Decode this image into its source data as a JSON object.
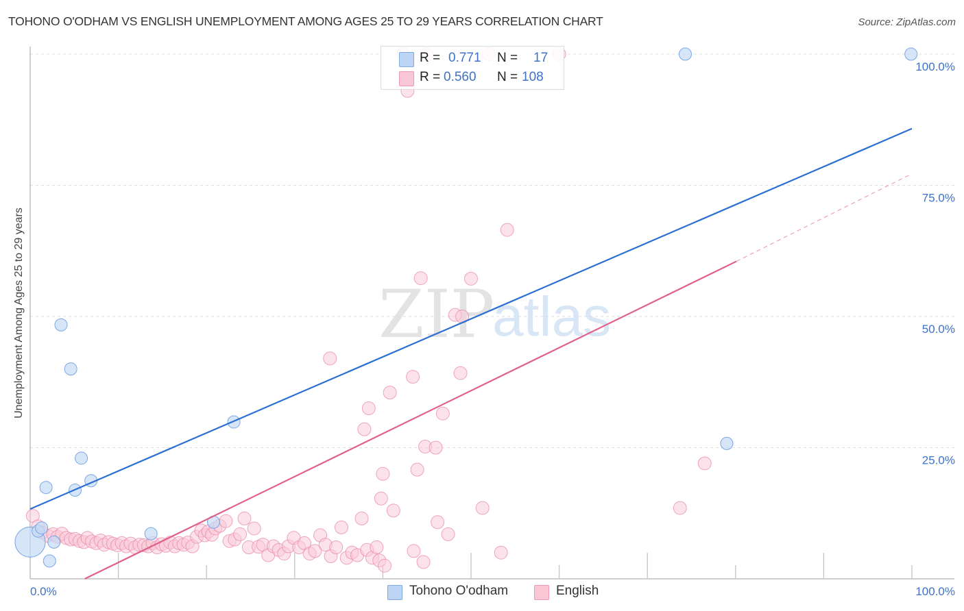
{
  "header": {
    "title": "TOHONO O'ODHAM VS ENGLISH UNEMPLOYMENT AMONG AGES 25 TO 29 YEARS CORRELATION CHART",
    "source": "Source: ZipAtlas.com"
  },
  "watermark": {
    "zip": "ZIP",
    "atlas": "atlas"
  },
  "legend": {
    "rows": [
      {
        "r_label": "R =",
        "r_value": "0.771",
        "n_label": "N =",
        "n_value": "17",
        "color": "#a9c8f0"
      },
      {
        "r_label": "R =",
        "r_value": "0.560",
        "n_label": "N =",
        "n_value": "108",
        "color": "#f7b8cb"
      }
    ]
  },
  "bottom_legend": [
    {
      "label": "Tohono O'odham",
      "color": "#a9c8f0"
    },
    {
      "label": "English",
      "color": "#f7b8cb"
    }
  ],
  "colors": {
    "blue_fill": "#c5daf5",
    "blue_stroke": "#6d9fe0",
    "blue_line": "#2a6fd1",
    "pink_fill": "#f9cad8",
    "pink_stroke": "#e98aa8",
    "pink_line": "#e0608a",
    "tick_text": "#3d72c8"
  },
  "chart_data": {
    "type": "scatter",
    "title": "TOHONO O'ODHAM VS ENGLISH UNEMPLOYMENT AMONG AGES 25 TO 29 YEARS CORRELATION CHART",
    "xlabel": "",
    "ylabel": "Unemployment Among Ages 25 to 29 years",
    "xlim": [
      0,
      100
    ],
    "ylim": [
      0,
      100
    ],
    "x_tick_labels": [
      "0.0%",
      "100.0%"
    ],
    "y_ticks": [
      25,
      50,
      75,
      100
    ],
    "y_tick_labels": [
      "25.0%",
      "50.0%",
      "75.0%",
      "100.0%"
    ],
    "grid": true,
    "legend_position": "top-center",
    "series": [
      {
        "name": "Tohono O'odham",
        "r": 0.771,
        "n": 17,
        "trend": {
          "x0": 0,
          "y0": 13.3,
          "x1": 100,
          "y1": 85.8
        },
        "points": [
          [
            0.0,
            7.0
          ],
          [
            0.9,
            9.1
          ],
          [
            1.3,
            9.7
          ],
          [
            1.8,
            17.4
          ],
          [
            2.2,
            3.4
          ],
          [
            2.7,
            7.0
          ],
          [
            3.5,
            48.4
          ],
          [
            4.6,
            40.0
          ],
          [
            5.1,
            16.9
          ],
          [
            5.8,
            23.0
          ],
          [
            6.9,
            18.7
          ],
          [
            13.7,
            8.6
          ],
          [
            20.8,
            10.8
          ],
          [
            23.1,
            29.9
          ],
          [
            74.3,
            100.0
          ],
          [
            79.0,
            25.8
          ],
          [
            99.9,
            100.0
          ]
        ],
        "point_sizes": [
          3,
          1,
          1,
          1,
          1,
          1,
          1,
          1,
          1,
          1,
          1,
          1,
          1,
          1,
          1,
          1,
          1
        ]
      },
      {
        "name": "English",
        "r": 0.56,
        "n": 108,
        "trend": {
          "x0": 6.2,
          "y0": 0,
          "x1": 80.1,
          "y1": 60.5,
          "dashed_to": {
            "x": 100,
            "y": 77.2
          }
        },
        "points": [
          [
            0.3,
            12.0
          ],
          [
            0.9,
            10.0
          ],
          [
            1.4,
            8.8
          ],
          [
            2.0,
            8.2
          ],
          [
            2.6,
            8.5
          ],
          [
            3.1,
            8.0
          ],
          [
            3.6,
            8.6
          ],
          [
            4.1,
            7.8
          ],
          [
            4.6,
            7.5
          ],
          [
            5.1,
            7.6
          ],
          [
            5.6,
            7.2
          ],
          [
            6.1,
            7.0
          ],
          [
            6.5,
            7.8
          ],
          [
            7.0,
            7.1
          ],
          [
            7.5,
            6.8
          ],
          [
            8.0,
            7.3
          ],
          [
            8.4,
            6.5
          ],
          [
            8.9,
            7.0
          ],
          [
            9.4,
            6.7
          ],
          [
            9.9,
            6.4
          ],
          [
            10.4,
            6.8
          ],
          [
            10.9,
            6.2
          ],
          [
            11.4,
            6.7
          ],
          [
            11.9,
            6.0
          ],
          [
            12.4,
            6.5
          ],
          [
            12.9,
            6.4
          ],
          [
            13.4,
            6.2
          ],
          [
            13.9,
            6.8
          ],
          [
            14.4,
            6.0
          ],
          [
            14.9,
            6.6
          ],
          [
            15.4,
            6.3
          ],
          [
            15.9,
            6.9
          ],
          [
            16.4,
            6.2
          ],
          [
            16.9,
            6.8
          ],
          [
            17.4,
            6.5
          ],
          [
            17.9,
            6.9
          ],
          [
            18.4,
            6.2
          ],
          [
            18.9,
            8.0
          ],
          [
            19.4,
            9.2
          ],
          [
            19.8,
            8.3
          ],
          [
            20.2,
            9.0
          ],
          [
            20.6,
            8.4
          ],
          [
            21.0,
            9.6
          ],
          [
            21.5,
            10.1
          ],
          [
            22.2,
            11.0
          ],
          [
            22.6,
            7.2
          ],
          [
            23.2,
            7.5
          ],
          [
            23.8,
            8.5
          ],
          [
            24.3,
            11.5
          ],
          [
            24.8,
            6.0
          ],
          [
            25.4,
            9.6
          ],
          [
            25.9,
            6.1
          ],
          [
            26.4,
            6.5
          ],
          [
            27.0,
            4.5
          ],
          [
            27.6,
            6.2
          ],
          [
            28.2,
            5.5
          ],
          [
            28.8,
            4.8
          ],
          [
            29.3,
            6.2
          ],
          [
            29.9,
            7.8
          ],
          [
            30.5,
            6.0
          ],
          [
            31.1,
            6.8
          ],
          [
            31.7,
            4.8
          ],
          [
            32.3,
            5.3
          ],
          [
            32.9,
            8.3
          ],
          [
            33.5,
            6.5
          ],
          [
            34.1,
            4.3
          ],
          [
            34.7,
            6.0
          ],
          [
            35.3,
            9.8
          ],
          [
            35.9,
            4.0
          ],
          [
            36.5,
            5.0
          ],
          [
            37.1,
            4.5
          ],
          [
            37.6,
            11.5
          ],
          [
            38.2,
            5.5
          ],
          [
            38.8,
            4.0
          ],
          [
            39.6,
            3.5
          ],
          [
            40.2,
            2.5
          ],
          [
            39.3,
            6.0
          ],
          [
            34.0,
            42.0
          ],
          [
            37.9,
            28.5
          ],
          [
            38.4,
            32.5
          ],
          [
            39.8,
            15.3
          ],
          [
            40.0,
            20.0
          ],
          [
            40.8,
            35.5
          ],
          [
            41.2,
            13.0
          ],
          [
            42.3,
            100.0
          ],
          [
            42.8,
            93.0
          ],
          [
            43.4,
            38.5
          ],
          [
            43.5,
            5.3
          ],
          [
            43.9,
            20.8
          ],
          [
            44.3,
            57.3
          ],
          [
            44.6,
            3.2
          ],
          [
            44.8,
            25.2
          ],
          [
            45.0,
            100.0
          ],
          [
            46.0,
            25.0
          ],
          [
            46.2,
            10.8
          ],
          [
            46.8,
            31.5
          ],
          [
            47.4,
            8.5
          ],
          [
            48.2,
            50.3
          ],
          [
            49.0,
            50.0
          ],
          [
            48.8,
            39.2
          ],
          [
            50.0,
            57.2
          ],
          [
            51.3,
            13.5
          ],
          [
            52.0,
            100.0
          ],
          [
            53.4,
            5.0
          ],
          [
            54.1,
            66.5
          ],
          [
            60.0,
            100.0
          ],
          [
            73.7,
            13.5
          ],
          [
            76.5,
            22.0
          ]
        ]
      }
    ]
  }
}
